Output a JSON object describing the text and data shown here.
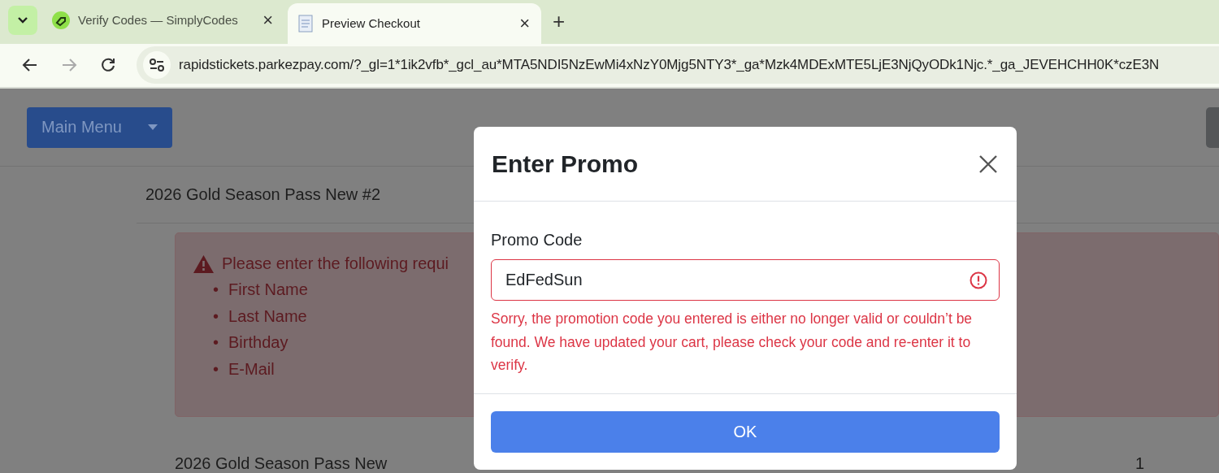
{
  "browser": {
    "tabs": [
      {
        "title": "Verify Codes — SimplyCodes",
        "selected": false,
        "close": "×"
      },
      {
        "title": "Preview Checkout",
        "selected": true,
        "close": "×"
      }
    ],
    "new_tab": "+",
    "address": "rapidstickets.parkezpay.com/?_gl=1*1ik2vfb*_gcl_au*MTA5NDI5NzEwMi4xNzY0Mjg5NTY3*_ga*Mzk4MDExMTE5LjE3NjQyODk1Njc.*_ga_JEVEHCHH0K*czE3N"
  },
  "page": {
    "main_menu": "Main Menu",
    "item_title": "2026 Gold Season Pass New #2",
    "alert": {
      "message": "Please enter the following requi",
      "fields": [
        {
          "bullet": "•",
          "label": "First Name"
        },
        {
          "bullet": "•",
          "label": "Last Name"
        },
        {
          "bullet": "•",
          "label": "Birthday"
        },
        {
          "bullet": "•",
          "label": "E-Mail"
        }
      ]
    },
    "next_item": "2026 Gold Season Pass New",
    "next_quantity": "1"
  },
  "modal": {
    "title": "Enter Promo",
    "label": "Promo Code",
    "value": "EdFedSun",
    "invalid": true,
    "error": "Sorry, the promotion code you entered is either no longer valid or couldn’t be found. We have updated your cart, please check your code and re-enter it to verify.",
    "button": "OK"
  }
}
